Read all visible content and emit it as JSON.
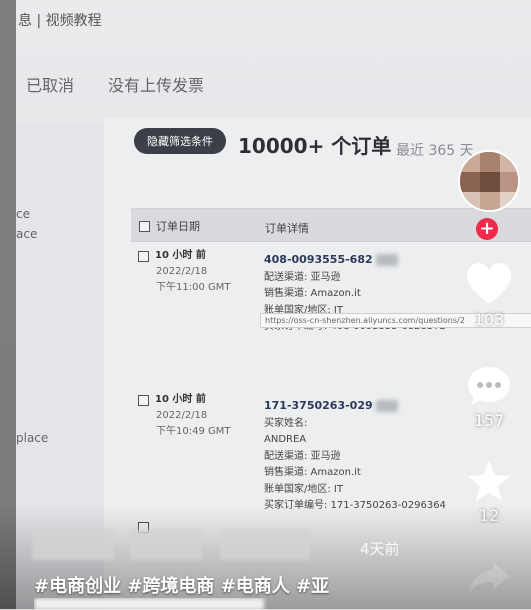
{
  "top": {
    "crumb": "息 | 视频教程"
  },
  "tabs": [
    "已取消",
    "没有上传发票"
  ],
  "sidebar": {
    "items": [
      "ce",
      "ace",
      "place"
    ]
  },
  "toolbar": {
    "filter_button": "隐藏筛选条件",
    "count": "10000+ 个订单",
    "recent": "最近 365 天"
  },
  "table": {
    "headers": {
      "date": "订单日期",
      "details": "订单详情"
    },
    "rows": [
      {
        "time_ago": "10 小时 前",
        "date": "2022/2/18",
        "time": "下午11:00 GMT",
        "order_number": "408-0093555-682",
        "lines": [
          "配送渠道: 亚马逊",
          "销售渠道: Amazon.it",
          "账单国家/地区: IT",
          "买家订单编号: 408-0093555-6828372"
        ]
      },
      {
        "time_ago": "10 小时 前",
        "date": "2022/2/18",
        "time": "下午10:49 GMT",
        "order_number": "171-3750263-029",
        "lines": [
          "买家姓名:",
          "ANDREA",
          "配送渠道: 亚马逊",
          "销售渠道: Amazon.it",
          "账单国家/地区: IT",
          "买家订单编号: 171-3750263-0296364"
        ]
      }
    ]
  },
  "url_tooltip": "https://oss-cn-shenzhen.aliyuncs.com/questions/2",
  "actions": {
    "likes": "103",
    "comments": "157",
    "favorites": "12"
  },
  "overlay": {
    "days_ago": "4天前",
    "hashtags": "#电商创业 #跨境电商 #电商人 #亚"
  }
}
